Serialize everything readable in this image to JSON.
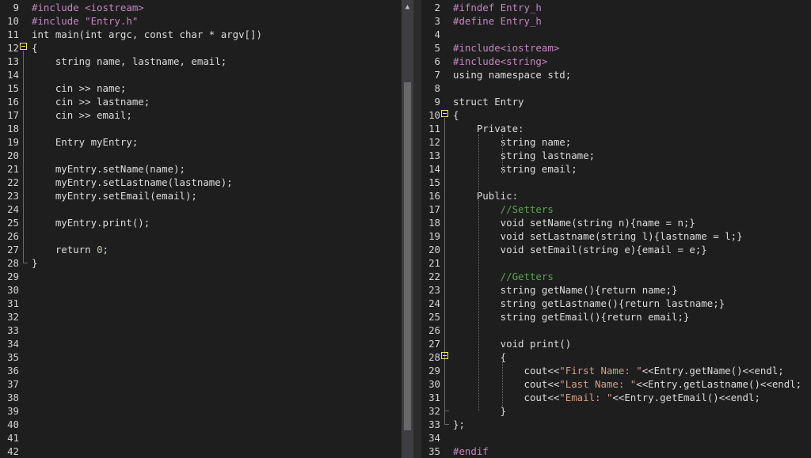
{
  "left_editor": {
    "lines": [
      {
        "num": "9",
        "text": "#include <iostream>",
        "kind": "pre"
      },
      {
        "num": "10",
        "text": "#include \"Entry.h\"",
        "kind": "pre"
      },
      {
        "num": "11",
        "text": "int main(int argc, const char * argv[])",
        "kind": "code"
      },
      {
        "num": "12",
        "text": "{",
        "kind": "code"
      },
      {
        "num": "13",
        "text": "    string name, lastname, email;",
        "kind": "code"
      },
      {
        "num": "14",
        "text": "",
        "kind": "code"
      },
      {
        "num": "15",
        "text": "    cin >> name;",
        "kind": "code"
      },
      {
        "num": "16",
        "text": "    cin >> lastname;",
        "kind": "code"
      },
      {
        "num": "17",
        "text": "    cin >> email;",
        "kind": "code"
      },
      {
        "num": "18",
        "text": "",
        "kind": "code"
      },
      {
        "num": "19",
        "text": "    Entry myEntry;",
        "kind": "code"
      },
      {
        "num": "20",
        "text": "",
        "kind": "code"
      },
      {
        "num": "21",
        "text": "    myEntry.setName(name);",
        "kind": "code"
      },
      {
        "num": "22",
        "text": "    myEntry.setLastname(lastname);",
        "kind": "code"
      },
      {
        "num": "23",
        "text": "    myEntry.setEmail(email);",
        "kind": "code"
      },
      {
        "num": "24",
        "text": "",
        "kind": "code"
      },
      {
        "num": "25",
        "text": "    myEntry.print();",
        "kind": "code"
      },
      {
        "num": "26",
        "text": "",
        "kind": "code"
      },
      {
        "num": "27",
        "text": "    return 0;",
        "kind": "code"
      },
      {
        "num": "28",
        "text": "}",
        "kind": "code"
      },
      {
        "num": "29",
        "text": "",
        "kind": "code"
      },
      {
        "num": "30",
        "text": "",
        "kind": "code"
      },
      {
        "num": "31",
        "text": "",
        "kind": "code"
      },
      {
        "num": "32",
        "text": "",
        "kind": "code"
      },
      {
        "num": "33",
        "text": "",
        "kind": "code"
      },
      {
        "num": "34",
        "text": "",
        "kind": "code"
      },
      {
        "num": "35",
        "text": "",
        "kind": "code"
      },
      {
        "num": "36",
        "text": "",
        "kind": "code"
      },
      {
        "num": "37",
        "text": "",
        "kind": "code"
      },
      {
        "num": "38",
        "text": "",
        "kind": "code"
      },
      {
        "num": "39",
        "text": "",
        "kind": "code"
      },
      {
        "num": "40",
        "text": "",
        "kind": "code"
      },
      {
        "num": "41",
        "text": "",
        "kind": "code"
      },
      {
        "num": "42",
        "text": "",
        "kind": "code"
      }
    ]
  },
  "right_editor": {
    "lines": [
      {
        "num": "2",
        "text": "#ifndef Entry_h",
        "kind": "pre"
      },
      {
        "num": "3",
        "text": "#define Entry_h",
        "kind": "pre"
      },
      {
        "num": "4",
        "text": "",
        "kind": "code"
      },
      {
        "num": "5",
        "text": "#include<iostream>",
        "kind": "pre"
      },
      {
        "num": "6",
        "text": "#include<string>",
        "kind": "pre"
      },
      {
        "num": "7",
        "text": "using namespace std;",
        "kind": "code"
      },
      {
        "num": "8",
        "text": "",
        "kind": "code"
      },
      {
        "num": "9",
        "text": "struct Entry",
        "kind": "code"
      },
      {
        "num": "10",
        "text": "{",
        "kind": "code"
      },
      {
        "num": "11",
        "text": "    Private:",
        "kind": "code"
      },
      {
        "num": "12",
        "text": "        string name;",
        "kind": "code"
      },
      {
        "num": "13",
        "text": "        string lastname;",
        "kind": "code"
      },
      {
        "num": "14",
        "text": "        string email;",
        "kind": "code"
      },
      {
        "num": "15",
        "text": "",
        "kind": "code"
      },
      {
        "num": "16",
        "text": "    Public:",
        "kind": "code"
      },
      {
        "num": "17",
        "text": "        //Setters",
        "kind": "com"
      },
      {
        "num": "18",
        "text": "        void setName(string n){name = n;}",
        "kind": "code"
      },
      {
        "num": "19",
        "text": "        void setLastname(string l){lastname = l;}",
        "kind": "code"
      },
      {
        "num": "20",
        "text": "        void setEmail(string e){email = e;}",
        "kind": "code"
      },
      {
        "num": "21",
        "text": "",
        "kind": "code"
      },
      {
        "num": "22",
        "text": "        //Getters",
        "kind": "com"
      },
      {
        "num": "23",
        "text": "        string getName(){return name;}",
        "kind": "code"
      },
      {
        "num": "24",
        "text": "        string getLastname(){return lastname;}",
        "kind": "code"
      },
      {
        "num": "25",
        "text": "        string getEmail(){return email;}",
        "kind": "code"
      },
      {
        "num": "26",
        "text": "",
        "kind": "code"
      },
      {
        "num": "27",
        "text": "        void print()",
        "kind": "code"
      },
      {
        "num": "28",
        "text": "        {",
        "kind": "code"
      },
      {
        "num": "29",
        "text": "            cout<<\"First Name: \"<<Entry.getName()<<endl;",
        "kind": "code"
      },
      {
        "num": "30",
        "text": "            cout<<\"Last Name: \"<<Entry.getLastname()<<endl;",
        "kind": "code"
      },
      {
        "num": "31",
        "text": "            cout<<\"Email: \"<<Entry.getEmail()<<endl;",
        "kind": "code"
      },
      {
        "num": "32",
        "text": "        }",
        "kind": "code"
      },
      {
        "num": "33",
        "text": "};",
        "kind": "code"
      },
      {
        "num": "34",
        "text": "",
        "kind": "code"
      },
      {
        "num": "35",
        "text": "#endif",
        "kind": "pre"
      }
    ]
  },
  "icons": {
    "scroll_up": "scroll-up-arrow-icon",
    "fold": "collapse-region-icon"
  },
  "colors": {
    "background": "#1e1e1e",
    "text": "#dcdcdc",
    "preprocessor": "#c586c0",
    "string": "#d69d85",
    "number": "#b5cea8",
    "comment": "#57a64a",
    "fold_marker": "#f0e36b"
  }
}
